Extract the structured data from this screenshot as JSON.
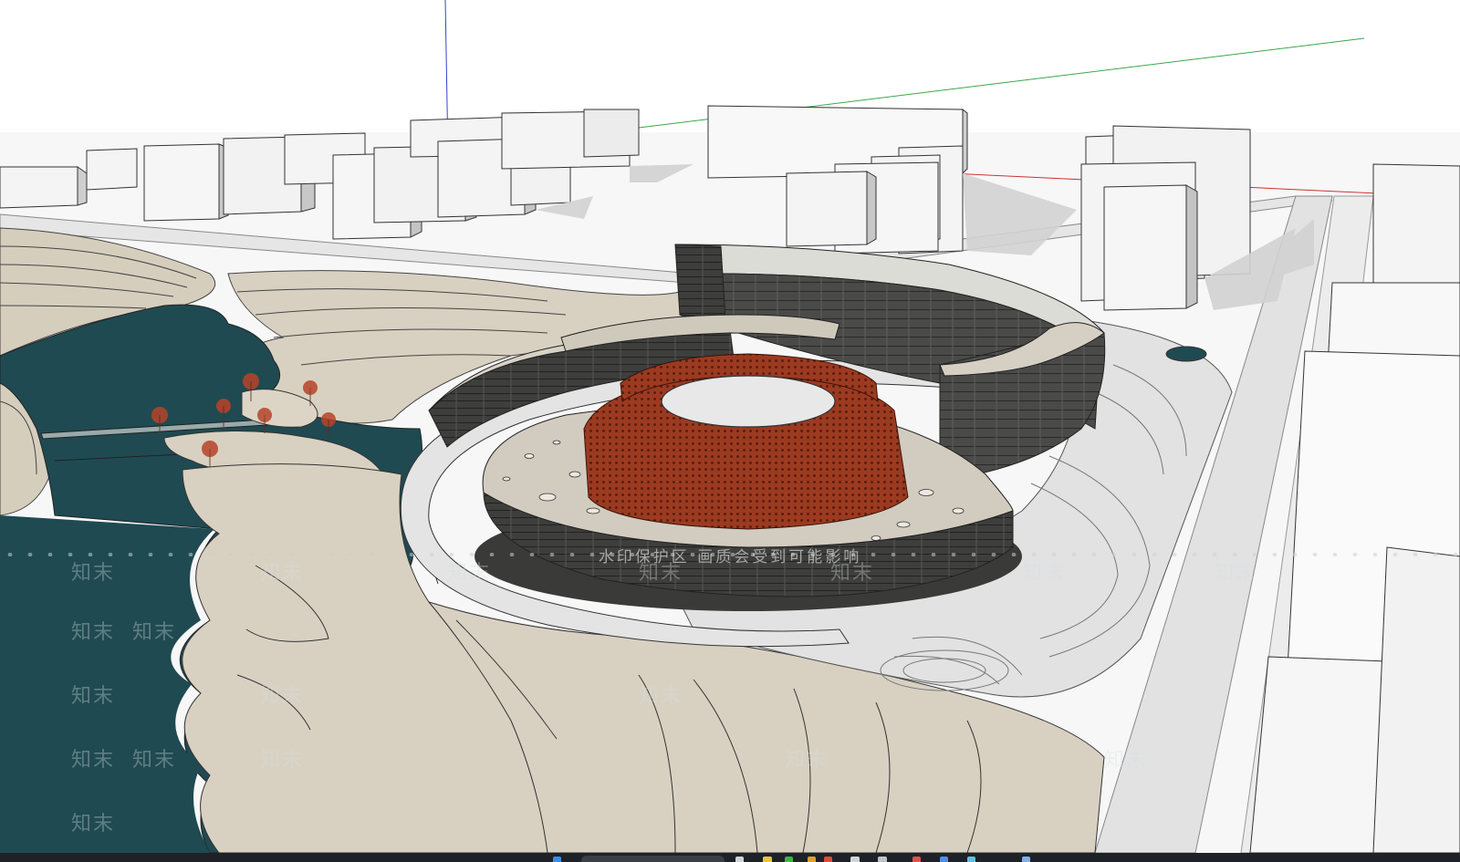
{
  "window": {
    "app": "SketchUp model viewport",
    "scene": "circular cultural center massing model"
  },
  "watermark": {
    "banner_text": "水印保护区 画质会受到可能影响",
    "tile_text": "知末"
  },
  "colors": {
    "water": "#1f4a52",
    "terrain": "#d8d1c2",
    "building_white": "#f4f4f4",
    "building_shadow": "#c8c8c8",
    "facade_dark": "#4a4a48",
    "corten": "#9c3a20",
    "plaza": "#dcdcdc",
    "axis_green": "#3aa84a",
    "axis_red": "#cc3333",
    "axis_blue": "#3344cc",
    "taskbar": "#1e2228"
  },
  "taskbar": {
    "icons": [
      {
        "name": "start-icon",
        "color": "#3a8ee6"
      },
      {
        "name": "search-icon",
        "color": "#3a3f47"
      },
      {
        "name": "file-explorer-icon",
        "color": "#f0c040"
      },
      {
        "name": "browser-icon",
        "color": "#3cb44a"
      },
      {
        "name": "mail-icon",
        "color": "#e04a3a"
      },
      {
        "name": "sketchup-icon",
        "color": "#d0d4d8"
      },
      {
        "name": "app-icon",
        "color": "#e05050"
      },
      {
        "name": "app-icon-2",
        "color": "#5090e0"
      }
    ]
  }
}
